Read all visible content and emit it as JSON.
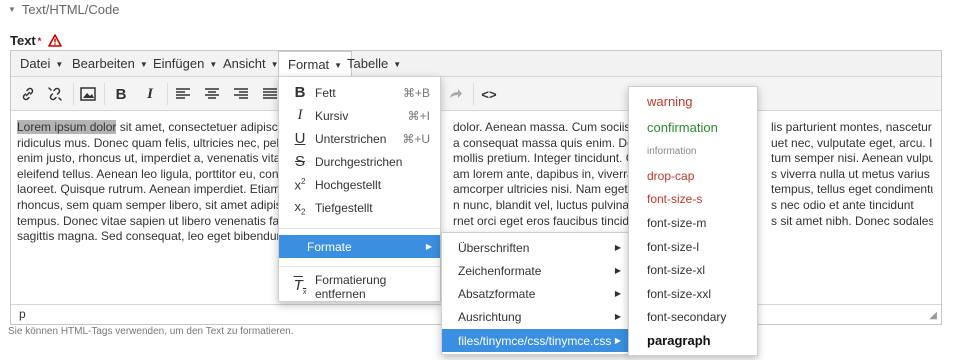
{
  "section": {
    "title": "Text/HTML/Code"
  },
  "field": {
    "label": "Text",
    "required_mark": "*"
  },
  "menubar": [
    {
      "label": "Datei"
    },
    {
      "label": "Bearbeiten"
    },
    {
      "label": "Einfügen"
    },
    {
      "label": "Ansicht"
    },
    {
      "label": "Format"
    },
    {
      "label": "Tabelle"
    }
  ],
  "content": {
    "selected": "Lorem ipsum dolor",
    "lines": [
      " sit amet, consectetuer adipiscing",
      "ridiculus mus. Donec quam felis, ultricies nec, pellen",
      "enim justo, rhoncus ut, imperdiet a, venenatis vitae, ju",
      "eleifend tellus. Aenean leo ligula, porttitor eu, consec",
      "laoreet. Quisque rutrum. Aenean imperdiet. Etiam ult",
      "rhoncus, sem quam semper libero, sit amet adipiscing",
      "tempus. Donec vitae sapien ut libero venenatis faucib",
      "sagittis magna. Sed consequat, leo eget bibendum so"
    ],
    "lines_mid": [
      "dolor. Aenean massa. Cum sociis natc",
      "a consequat massa quis enim. Donec p",
      "mollis pretium. Integer tincidunt. Cras",
      "am lorem ante, dapibus in, viverra qui",
      "amcorper ultricies nisi. Nam eget dui.",
      "n nunc, blandit vel, luctus pulvinar, he",
      "rnet orci eget eros faucibus tincidunt. I",
      ""
    ],
    "lines_right": [
      "lis parturient montes, nascetur",
      "uet nec, vulputate eget, arcu. In",
      "tum semper nisi. Aenean vulputate",
      "s viverra nulla ut metus varius",
      "tempus, tellus eget condimentum",
      "s nec odio et ante tincidunt",
      "s sit amet nibh. Donec sodales",
      ""
    ]
  },
  "statusbar": {
    "path": "p"
  },
  "help_text": "Sie können HTML-Tags verwenden, um den Text zu formatieren.",
  "format_menu": {
    "items": [
      {
        "label": "Fett",
        "shortcut": "⌘+B",
        "icon": "bold-icon"
      },
      {
        "label": "Kursiv",
        "shortcut": "⌘+I",
        "icon": "italic-icon"
      },
      {
        "label": "Unterstrichen",
        "shortcut": "⌘+U",
        "icon": "underline-icon"
      },
      {
        "label": "Durchgestrichen",
        "shortcut": "",
        "icon": "strikethrough-icon"
      },
      {
        "label": "Hochgestellt",
        "shortcut": "",
        "icon": "superscript-icon"
      },
      {
        "label": "Tiefgestellt",
        "shortcut": "",
        "icon": "subscript-icon"
      }
    ],
    "formats": "Formate",
    "clear": "Formatierung entfernen"
  },
  "formats_submenu": [
    {
      "label": "Überschriften"
    },
    {
      "label": "Zeichenformate"
    },
    {
      "label": "Absatzformate"
    },
    {
      "label": "Ausrichtung"
    },
    {
      "label": "files/tinymce/css/tinymce.css"
    }
  ],
  "css_submenu": [
    {
      "label": "warning",
      "color": "#c0392b"
    },
    {
      "label": "confirmation",
      "color": "#2e8b2e"
    },
    {
      "label": "information",
      "color": "#888888"
    },
    {
      "label": "drop-cap",
      "color": "#c0392b"
    },
    {
      "label": "font-size-s",
      "color": "#c0392b"
    },
    {
      "label": "font-size-m",
      "color": "#333333"
    },
    {
      "label": "font-size-l",
      "color": "#333333"
    },
    {
      "label": "font-size-xl",
      "color": "#333333"
    },
    {
      "label": "font-size-xxl",
      "color": "#333333"
    },
    {
      "label": "font-secondary",
      "color": "#333333"
    },
    {
      "label": "paragraph",
      "color": "#111111"
    }
  ],
  "colors": {
    "accent": "#3a8fe0",
    "warning": "#c0392b"
  }
}
